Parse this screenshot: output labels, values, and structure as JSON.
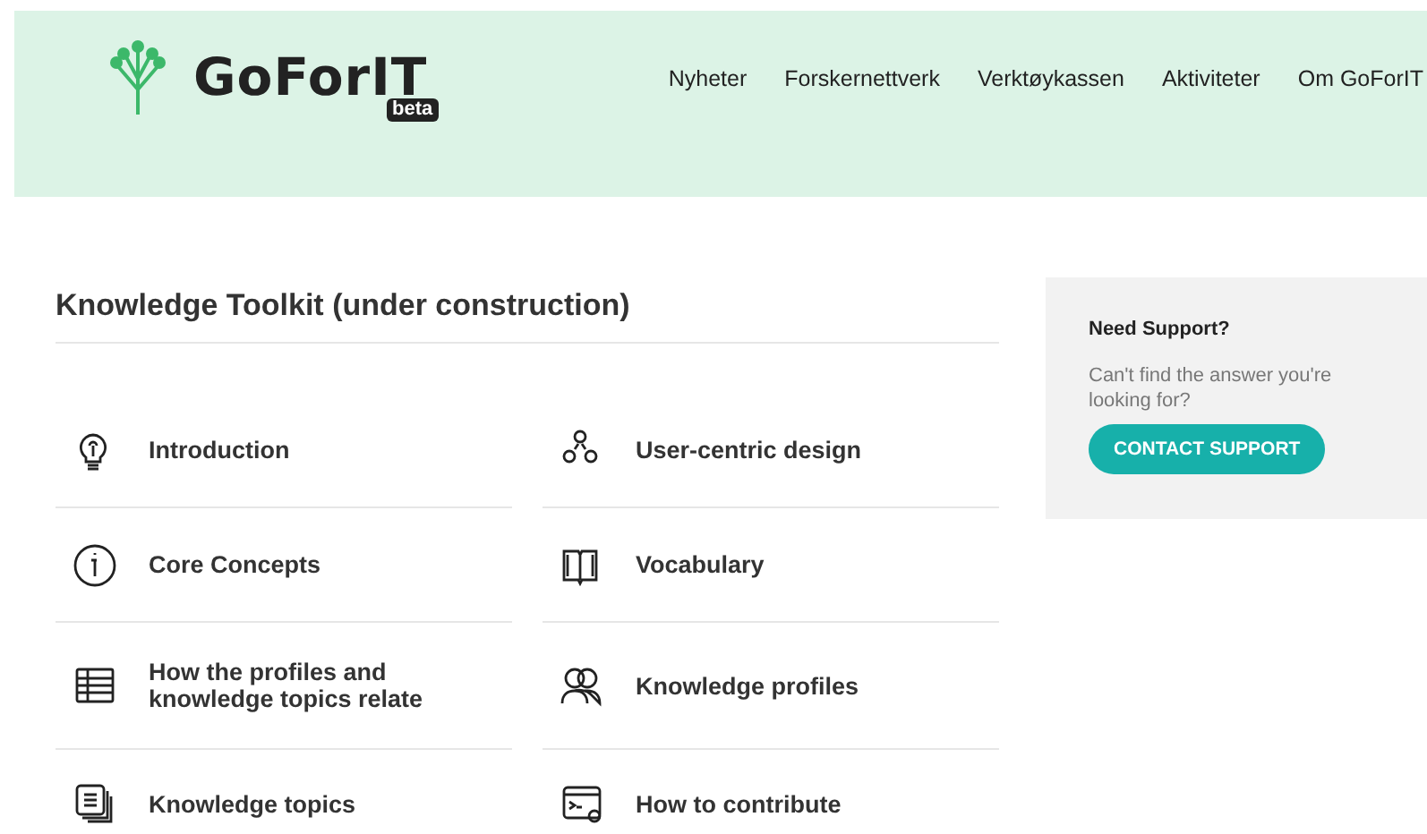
{
  "header": {
    "logo": {
      "name": "GoForIT",
      "badge": "beta"
    },
    "nav": [
      {
        "label": "Nyheter"
      },
      {
        "label": "Forskernettverk"
      },
      {
        "label": "Verktøykassen"
      },
      {
        "label": "Aktiviteter"
      },
      {
        "label": "Om GoForIT"
      }
    ]
  },
  "toolkit": {
    "title": "Knowledge Toolkit (under construction)",
    "items": [
      {
        "label": "Introduction"
      },
      {
        "label": "User-centric design"
      },
      {
        "label": "Core Concepts"
      },
      {
        "label": "Vocabulary"
      },
      {
        "label": "How the profiles and knowledge topics relate"
      },
      {
        "label": "Knowledge profiles"
      },
      {
        "label": "Knowledge topics"
      },
      {
        "label": "How to contribute"
      }
    ]
  },
  "support": {
    "title": "Need Support?",
    "text": "Can't find the answer you're looking for?",
    "button": "CONTACT SUPPORT"
  }
}
